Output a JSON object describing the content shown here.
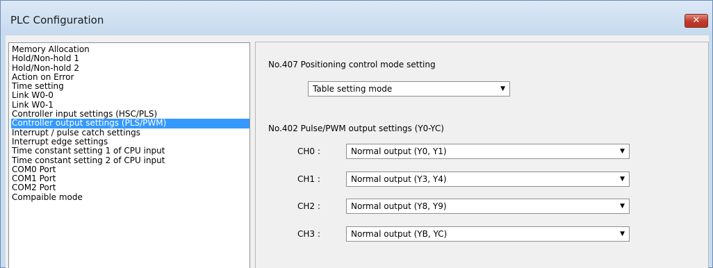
{
  "window": {
    "title": "PLC Configuration",
    "close_glyph": "✕"
  },
  "tree": {
    "items": [
      "Memory Allocation",
      "Hold/Non-hold 1",
      "Hold/Non-hold 2",
      "Action on Error",
      "Time setting",
      "Link W0-0",
      "Link W0-1",
      "Controller input settings (HSC/PLS)",
      "Controller output settings (PLS/PWM)",
      "Interrupt / pulse catch settings",
      "Interrupt edge settings",
      "Time constant setting 1 of CPU input",
      "Time constant setting 2 of CPU input",
      "COM0 Port",
      "COM1 Port",
      "COM2 Port",
      "Compaible mode"
    ],
    "selected_index": 8
  },
  "panel": {
    "positioning_label": "No.407 Positioning control mode setting",
    "positioning_value": "Table setting mode",
    "pulse_label": "No.402 Pulse/PWM output settings (Y0-YC)",
    "channels": [
      {
        "label": "CH0 :",
        "value": "Normal output (Y0, Y1)"
      },
      {
        "label": "CH1 :",
        "value": "Normal output (Y3, Y4)"
      },
      {
        "label": "CH2 :",
        "value": "Normal output (Y8, Y9)"
      },
      {
        "label": "CH3 :",
        "value": "Normal output (YB, YC)"
      }
    ],
    "dropdown_arrow": "▼"
  },
  "colors": {
    "selection": "#3399ff",
    "close_button": "#c0392b"
  }
}
